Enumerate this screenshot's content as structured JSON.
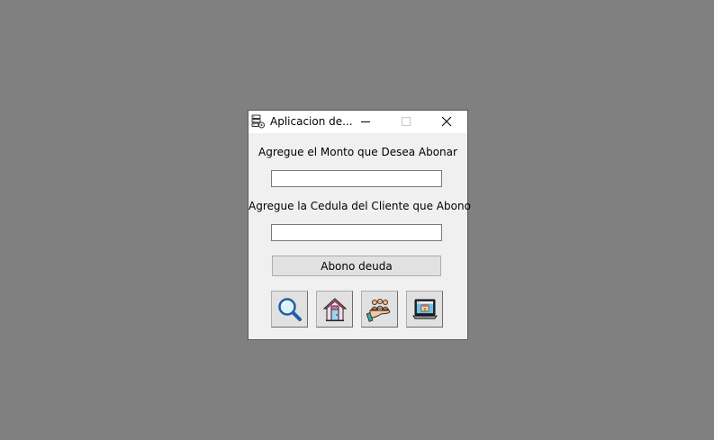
{
  "window": {
    "title": "Aplicacion de...",
    "app_icon": "database-settings-icon"
  },
  "titlebar_buttons": {
    "minimize": "minimize-icon",
    "maximize": "maximize-icon",
    "close": "close-icon"
  },
  "form": {
    "monto_label": "Agregue el Monto que Desea Abonar",
    "monto_value": "",
    "cedula_label": "Agregue la Cedula del Cliente que Abono",
    "cedula_value": "",
    "submit_label": "Abono deuda"
  },
  "toolbar_icons": [
    {
      "icon": "search-icon"
    },
    {
      "icon": "home-icon"
    },
    {
      "icon": "clients-hand-icon"
    },
    {
      "icon": "online-store-icon"
    }
  ]
}
